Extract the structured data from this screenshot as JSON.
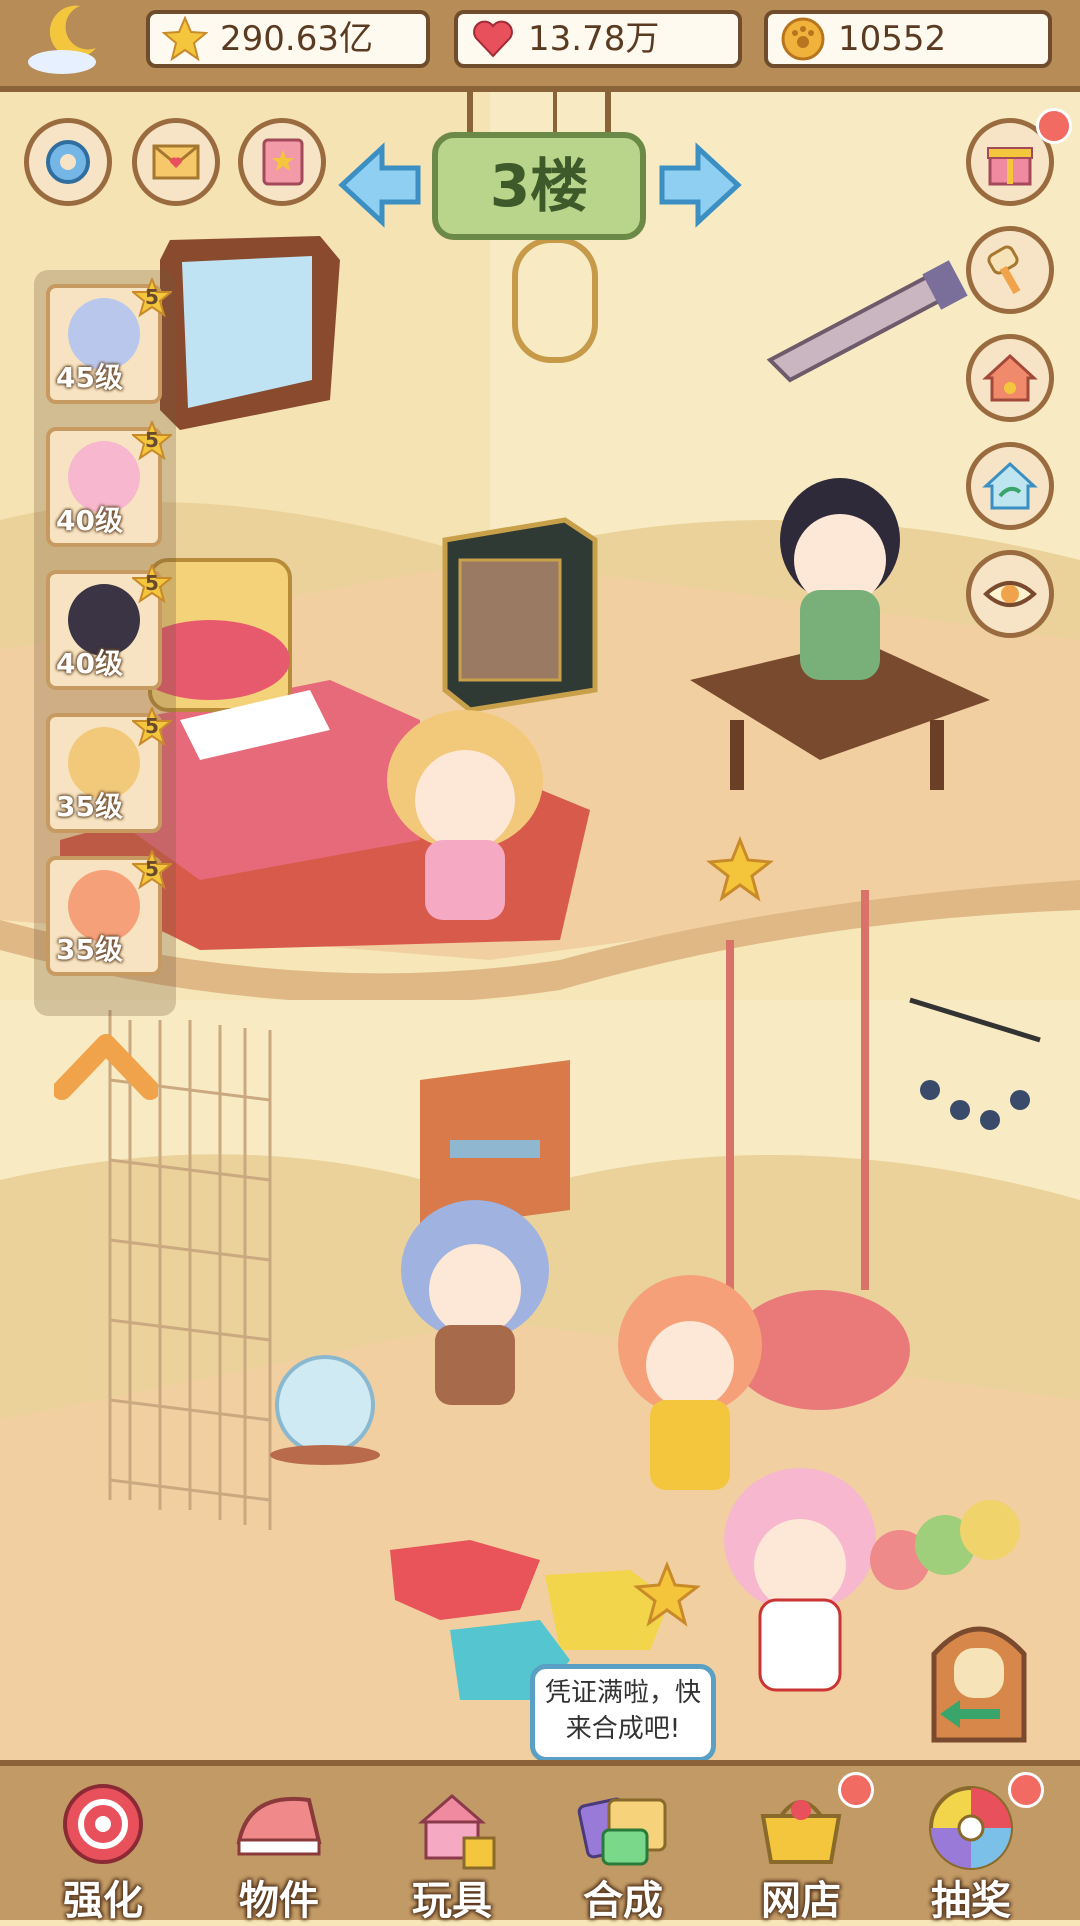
{
  "resources": {
    "stars": "290.63亿",
    "hearts": "13.78万",
    "coins": "10552"
  },
  "floor": {
    "label": "3楼"
  },
  "characters": [
    {
      "level": "45级",
      "rank": "5"
    },
    {
      "level": "40级",
      "rank": "5"
    },
    {
      "level": "40级",
      "rank": "5"
    },
    {
      "level": "35级",
      "rank": "5"
    },
    {
      "level": "35级",
      "rank": "5"
    }
  ],
  "bubble": {
    "line1": "凭证满啦，快",
    "line2": "来合成吧!"
  },
  "nav": [
    {
      "label": "强化"
    },
    {
      "label": "物件"
    },
    {
      "label": "玩具"
    },
    {
      "label": "合成"
    },
    {
      "label": "网店"
    },
    {
      "label": "抽奖"
    }
  ],
  "colors": {
    "wall": "#f6e6b8",
    "floor": "#f1cfa1",
    "frame": "#b78c57",
    "notify": "#f26b63"
  }
}
